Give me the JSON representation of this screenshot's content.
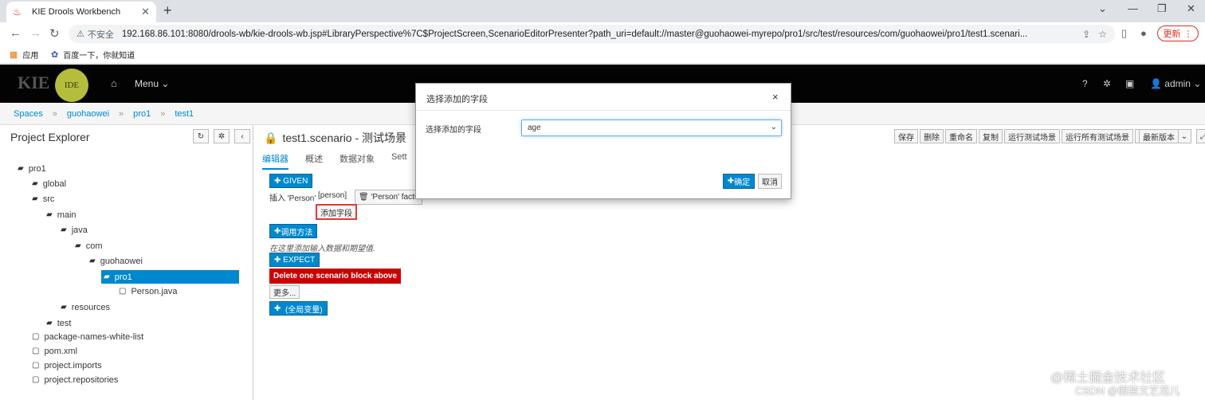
{
  "browser": {
    "tab_title": "KIE Drools Workbench",
    "insecure_label": "不安全",
    "url": "192.168.86.101:8080/drools-wb/kie-drools-wb.jsp#LibraryPerspective%7C$ProjectScreen,ScenarioEditorPresenter?path_uri=default://master@guohaowei-myrepo/pro1/src/test/resources/com/guohaowei/pro1/test1.scenari...",
    "update_label": "更新",
    "bookmarks": [
      "应用",
      "百度一下，你就知道"
    ]
  },
  "navbar": {
    "logo": "KIE",
    "ide": "IDE",
    "menu": "Menu",
    "user": "admin"
  },
  "breadcrumb": [
    "Spaces",
    "guohaowei",
    "pro1",
    "test1"
  ],
  "explorer": {
    "title": "Project Explorer",
    "tree": [
      {
        "label": "pro1",
        "type": "folder"
      },
      {
        "label": "global",
        "type": "folder"
      },
      {
        "label": "src",
        "type": "folder"
      },
      {
        "label": "main",
        "type": "folder"
      },
      {
        "label": "java",
        "type": "folder"
      },
      {
        "label": "com",
        "type": "folder"
      },
      {
        "label": "guohaowei",
        "type": "folder"
      },
      {
        "label": "pro1",
        "type": "folder"
      },
      {
        "label": "Person.java",
        "type": "file"
      },
      {
        "label": "resources",
        "type": "folder"
      },
      {
        "label": "test",
        "type": "folder"
      },
      {
        "label": "package-names-white-list",
        "type": "file"
      },
      {
        "label": "pom.xml",
        "type": "file"
      },
      {
        "label": "project.imports",
        "type": "file"
      },
      {
        "label": "project.repositories",
        "type": "file"
      }
    ]
  },
  "editor": {
    "title": "test1.scenario - 测试场景",
    "tabs": [
      "编辑器",
      "概述",
      "数据对象",
      "Sett"
    ],
    "toolbar": [
      "保存",
      "删除",
      "重命名",
      "复制",
      "运行测试场景",
      "运行所有测试场景",
      "最新版本"
    ],
    "given": "GIVEN",
    "insert_text": "插入 'Person'",
    "person_var": "[person]",
    "person_facts": "'Person' facts",
    "add_field": "添加字段",
    "call_method": "调用方法",
    "hint": "在这里添加输入数据和期望值.",
    "expect": "EXPECT",
    "delete_block": "Delete one scenario block above",
    "more": "更多...",
    "globals": "(全局变量)"
  },
  "modal": {
    "title": "选择添加的字段",
    "label": "选择添加的字段",
    "selected": "age",
    "ok": "确定",
    "cancel": "取消"
  },
  "watermark": {
    "line1": "@稀土掘金技术社区",
    "line2": "CSDN @假装文艺范儿"
  }
}
